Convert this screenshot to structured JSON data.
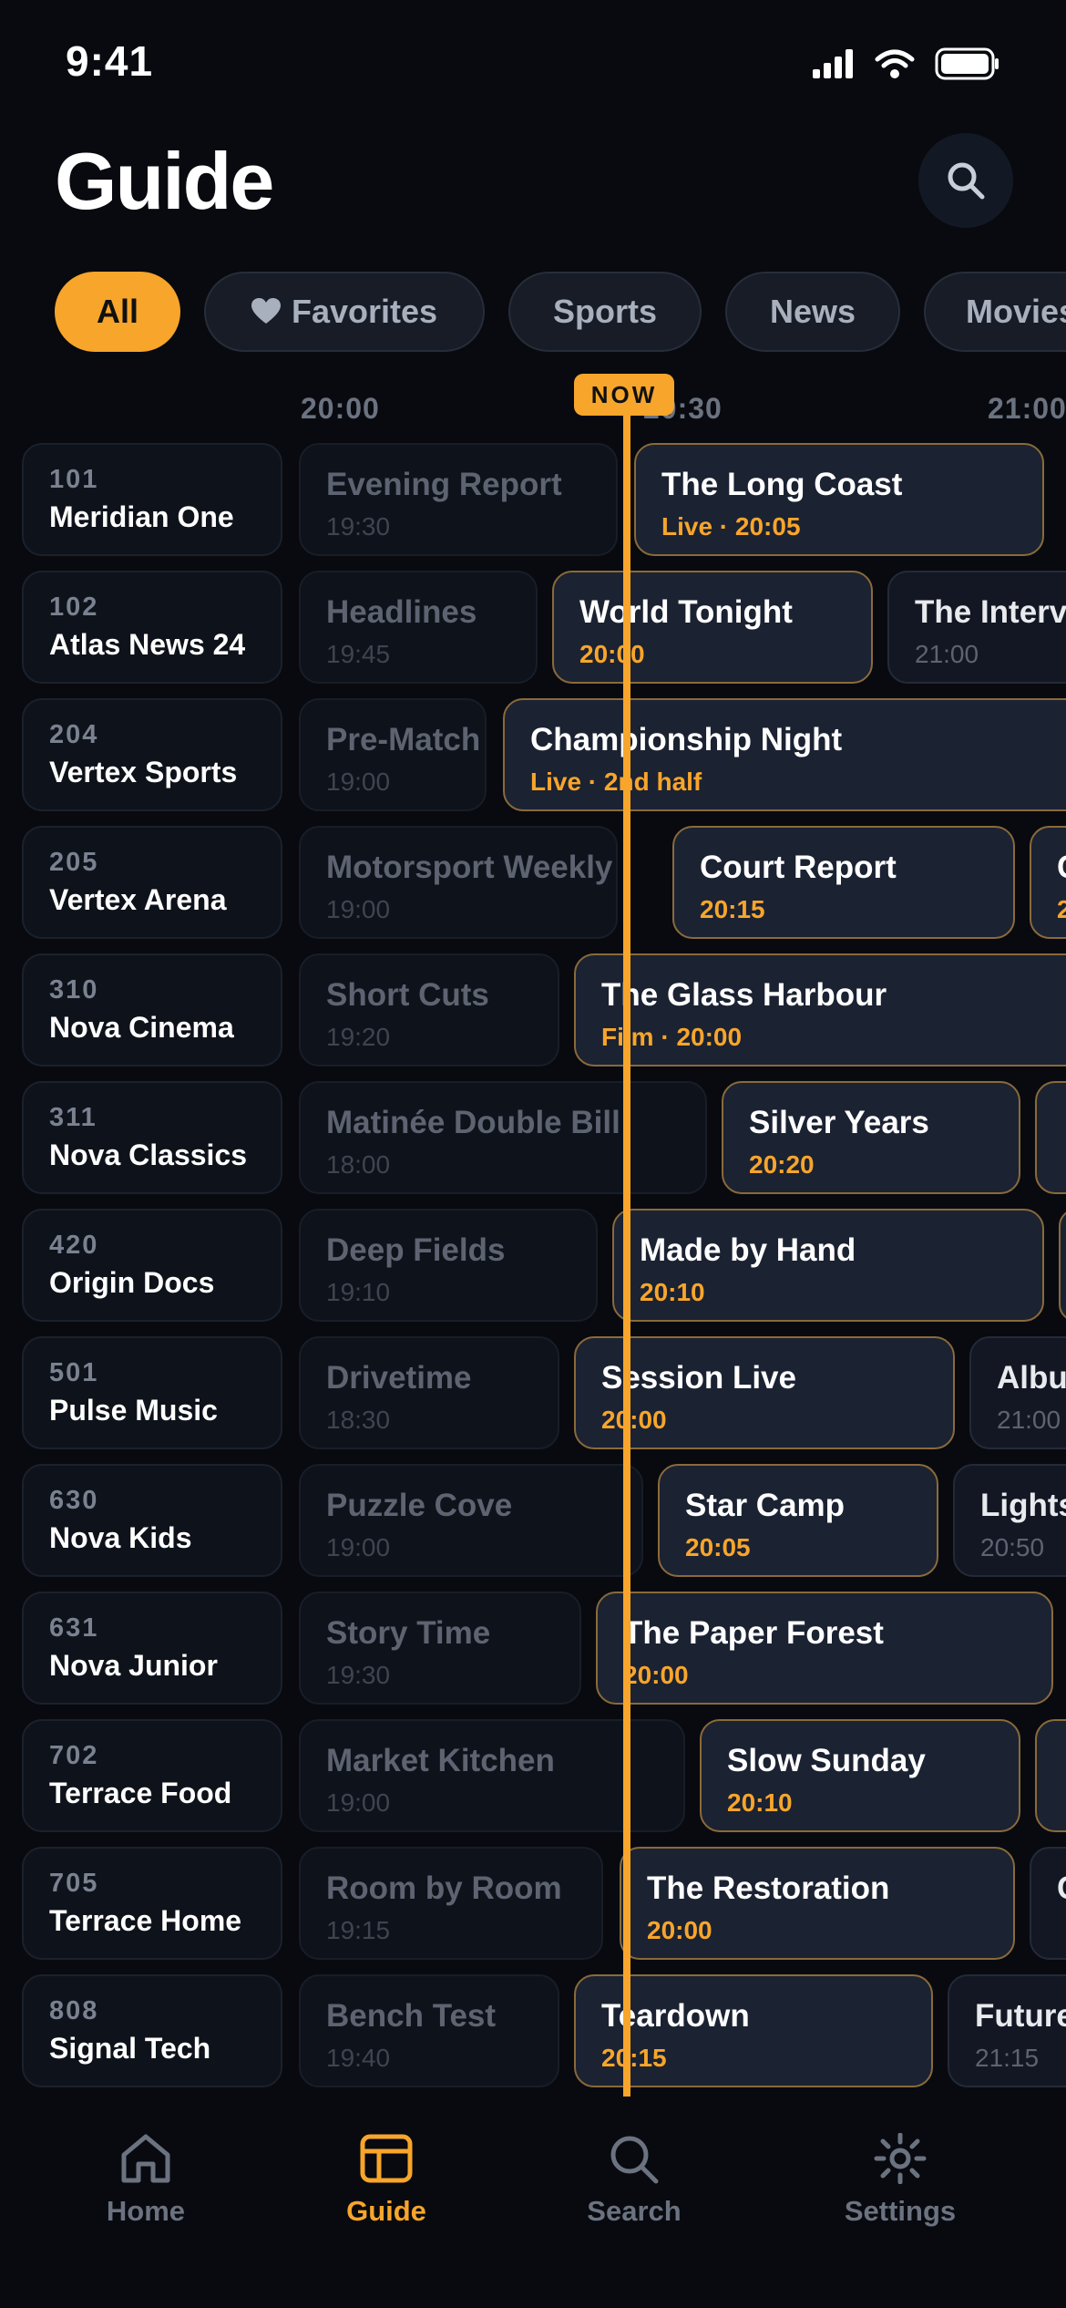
{
  "status_bar": {
    "time": "9:41"
  },
  "header": {
    "title": "Guide"
  },
  "filters": [
    {
      "label": "All",
      "active": true
    },
    {
      "label": "Favorites",
      "icon": "heart-icon"
    },
    {
      "label": "Sports"
    },
    {
      "label": "News"
    },
    {
      "label": "Movies"
    }
  ],
  "timeline": {
    "times": [
      "20:00",
      "20:30",
      "21:00"
    ],
    "now_label": "NOW"
  },
  "channels": [
    {
      "number": "101",
      "name": "Meridian One",
      "programs": [
        {
          "title": "Evening Report",
          "subtitle": "19:30",
          "state": "past"
        },
        {
          "title": "The Long Coast",
          "subtitle": "Live · 20:05",
          "state": "current"
        }
      ]
    },
    {
      "number": "102",
      "name": "Atlas News 24",
      "programs": [
        {
          "title": "Headlines",
          "subtitle": "19:45",
          "state": "past"
        },
        {
          "title": "World Tonight",
          "subtitle": "20:00",
          "state": "current"
        },
        {
          "title": "The Interview",
          "subtitle": "21:00",
          "state": "future"
        }
      ]
    },
    {
      "number": "204",
      "name": "Vertex Sports",
      "programs": [
        {
          "title": "Pre-Match",
          "subtitle": "19:00",
          "state": "past"
        },
        {
          "title": "Championship Night",
          "subtitle": "Live · 2nd half",
          "state": "current"
        }
      ]
    },
    {
      "number": "205",
      "name": "Vertex Arena",
      "programs": [
        {
          "title": "Motorsport Weekly",
          "subtitle": "19:00",
          "state": "past"
        },
        {
          "title": "Court Report",
          "subtitle": "20:15",
          "state": "current"
        },
        {
          "title": "C",
          "subtitle": "2",
          "state": "current"
        }
      ]
    },
    {
      "number": "310",
      "name": "Nova Cinema",
      "programs": [
        {
          "title": "Short Cuts",
          "subtitle": "19:20",
          "state": "past"
        },
        {
          "title": "The Glass Harbour",
          "subtitle": "Film · 20:00",
          "state": "current"
        }
      ]
    },
    {
      "number": "311",
      "name": "Nova Classics",
      "programs": [
        {
          "title": "Matinée Double Bill",
          "subtitle": "18:00",
          "state": "past"
        },
        {
          "title": "Silver Years",
          "subtitle": "20:20",
          "state": "current"
        },
        {
          "title": "",
          "subtitle": "",
          "state": "current"
        }
      ]
    },
    {
      "number": "420",
      "name": "Origin Docs",
      "programs": [
        {
          "title": "Deep Fields",
          "subtitle": "19:10",
          "state": "past"
        },
        {
          "title": "Made by Hand",
          "subtitle": "20:10",
          "state": "current"
        },
        {
          "title": "",
          "subtitle": "",
          "state": "current"
        }
      ]
    },
    {
      "number": "501",
      "name": "Pulse Music",
      "programs": [
        {
          "title": "Drivetime",
          "subtitle": "18:30",
          "state": "past"
        },
        {
          "title": "Session Live",
          "subtitle": "20:00",
          "state": "current"
        },
        {
          "title": "Album",
          "subtitle": "21:00",
          "state": "future"
        }
      ]
    },
    {
      "number": "630",
      "name": "Nova Kids",
      "programs": [
        {
          "title": "Puzzle Cove",
          "subtitle": "19:00",
          "state": "past"
        },
        {
          "title": "Star Camp",
          "subtitle": "20:05",
          "state": "current"
        },
        {
          "title": "Lights",
          "subtitle": "20:50",
          "state": "future"
        }
      ]
    },
    {
      "number": "631",
      "name": "Nova Junior",
      "programs": [
        {
          "title": "Story Time",
          "subtitle": "19:30",
          "state": "past"
        },
        {
          "title": "The Paper Forest",
          "subtitle": "20:00",
          "state": "current"
        }
      ]
    },
    {
      "number": "702",
      "name": "Terrace Food",
      "programs": [
        {
          "title": "Market Kitchen",
          "subtitle": "19:00",
          "state": "past"
        },
        {
          "title": "Slow Sunday",
          "subtitle": "20:10",
          "state": "current"
        },
        {
          "title": "",
          "subtitle": "",
          "state": "current"
        }
      ]
    },
    {
      "number": "705",
      "name": "Terrace Home",
      "programs": [
        {
          "title": "Room by Room",
          "subtitle": "19:15",
          "state": "past"
        },
        {
          "title": "The Restoration",
          "subtitle": "20:00",
          "state": "current"
        },
        {
          "title": "C",
          "subtitle": "",
          "state": "future"
        }
      ]
    },
    {
      "number": "808",
      "name": "Signal Tech",
      "programs": [
        {
          "title": "Bench Test",
          "subtitle": "19:40",
          "state": "past"
        },
        {
          "title": "Teardown",
          "subtitle": "20:15",
          "state": "current"
        },
        {
          "title": "Future",
          "subtitle": "21:15",
          "state": "future"
        }
      ]
    }
  ],
  "tab_bar": [
    {
      "label": "Home",
      "icon": "home-icon"
    },
    {
      "label": "Guide",
      "icon": "guide-icon",
      "active": true
    },
    {
      "label": "Search",
      "icon": "search-icon"
    },
    {
      "label": "Settings",
      "icon": "settings-icon"
    }
  ],
  "colors": {
    "accent": "#f7a52b",
    "background": "#080a0f"
  }
}
